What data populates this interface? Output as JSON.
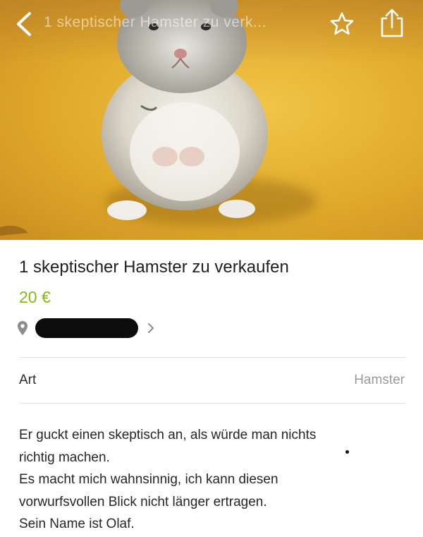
{
  "header": {
    "title_overlay": "1 skeptischer Hamster zu verk...",
    "back_icon": "chevron-left-icon",
    "favorite_icon": "star-outline-icon",
    "share_icon": "share-icon"
  },
  "hero": {
    "photo_subject": "hamster",
    "background_color": "#e5b237"
  },
  "listing": {
    "title": "1 skeptischer Hamster zu verkaufen",
    "price": "20 €",
    "price_color": "#86b817",
    "location_icon": "map-pin-icon",
    "location_chevron_icon": "chevron-right-icon"
  },
  "attributes": [
    {
      "label": "Art",
      "value": "Hamster"
    }
  ],
  "description": {
    "lines": [
      "Er guckt einen skeptisch an, als würde man nichts",
      "richtig machen.",
      "Es macht mich wahnsinnig, ich kann diesen",
      "vorwurfsvollen Blick nicht länger ertragen.",
      "Sein Name ist Olaf."
    ]
  }
}
